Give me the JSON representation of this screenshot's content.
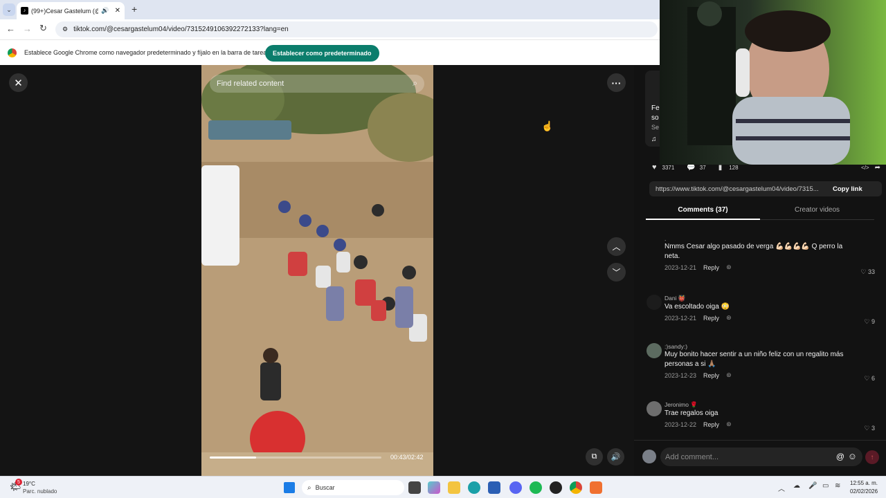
{
  "browser": {
    "tab_title": "(99+)Cesar Gastelum (@ce",
    "url": "tiktok.com/@cesargastelum04/video/7315249106392272133?lang=en",
    "infobar_text": "Establece Google Chrome como navegador predeterminado y fíjalo en la barra de tareas",
    "infobar_button": "Establecer como predeterminado"
  },
  "player": {
    "search_placeholder": "Find related content",
    "time": "00:43/02:42",
    "progress": 0.27
  },
  "video_info": {
    "frag1": "Fe",
    "frag2": "so",
    "frag3": "Se"
  },
  "actions": {
    "likes": "3371",
    "comments": "37",
    "saves": "128"
  },
  "share": {
    "link": "https://www.tiktok.com/@cesargastelum04/video/7315...",
    "copy_label": "Copy link"
  },
  "tabs": {
    "comments": "Comments (37)",
    "creator": "Creator videos"
  },
  "comments": [
    {
      "name": ".",
      "text": "Nmms Cesar algo pasado de verga 💪🏻💪🏻💪🏻💪🏻 Q perro la neta.",
      "date": "2023-12-21",
      "reply": "Reply",
      "likes": "33"
    },
    {
      "name": "Dani 👹",
      "text": "Va escoltado oiga 😳",
      "date": "2023-12-21",
      "reply": "Reply",
      "likes": "9"
    },
    {
      "name": ":)sandy:)",
      "text": "Muy bonito hacer sentir a un niño feliz con un regalito más personas a si 🙏🏽",
      "date": "2023-12-23",
      "reply": "Reply",
      "likes": "6"
    },
    {
      "name": "Jeronimo 🌹",
      "text": "Trae regalos oiga",
      "date": "2023-12-22",
      "reply": "Reply",
      "likes": "3"
    }
  ],
  "add_comment_placeholder": "Add comment...",
  "taskbar": {
    "temp": "19°C",
    "weather": "Parc. nublado",
    "weather_badge": "5",
    "search": "Buscar",
    "time": "12:55 a. m.",
    "date": "02/02/2026"
  },
  "colors": {
    "accent": "#fe2c55",
    "chrome_green": "#0b7d6c"
  }
}
